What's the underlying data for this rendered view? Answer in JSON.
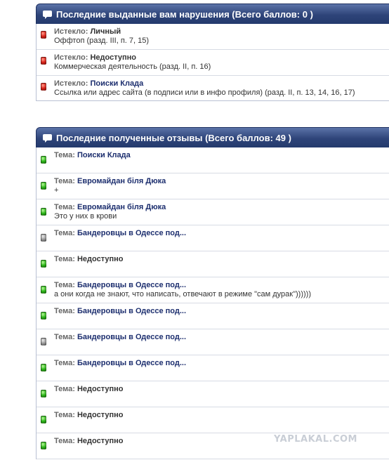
{
  "violations": {
    "header": "Последние выданные вам нарушения (Всего баллов: 0 )",
    "items": [
      {
        "status": "red",
        "label": "Истекло:",
        "title": "Личный",
        "title_style": "plain",
        "detail": "Оффтоп (разд. III, п. 7, 15)"
      },
      {
        "status": "red",
        "label": "Истекло:",
        "title": "Недоступно",
        "title_style": "plain",
        "detail": "Коммерческая деятельность (разд. II, п. 16)"
      },
      {
        "status": "red",
        "label": "Истекло:",
        "title": "Поиски Клада",
        "title_style": "link",
        "detail": "Ссылка или адрес сайта (в подписи или в инфо профиля) (разд. II, п. 13, 14, 16, 17)"
      }
    ]
  },
  "reviews": {
    "header": "Последние полученные отзывы (Всего баллов: 49 )",
    "items": [
      {
        "status": "green",
        "label": "Тема:",
        "title": "Поиски Клада",
        "title_style": "link",
        "detail": ""
      },
      {
        "status": "green",
        "label": "Тема:",
        "title": "Евромайдан біля Дюка",
        "title_style": "link",
        "detail": "+"
      },
      {
        "status": "green",
        "label": "Тема:",
        "title": "Евромайдан біля Дюка",
        "title_style": "link",
        "detail": "Это у них в крови"
      },
      {
        "status": "gray",
        "label": "Тема:",
        "title": "Бандеровцы в Одессе под...",
        "title_style": "link",
        "detail": ""
      },
      {
        "status": "green",
        "label": "Тема:",
        "title": "Недоступно",
        "title_style": "plain",
        "detail": ""
      },
      {
        "status": "green",
        "label": "Тема:",
        "title": "Бандеровцы в Одессе под...",
        "title_style": "link",
        "detail": "а они когда не знают, что написать, отвечают в режиме \"сам дурак\"))))))"
      },
      {
        "status": "green",
        "label": "Тема:",
        "title": "Бандеровцы в Одессе под...",
        "title_style": "link",
        "detail": ""
      },
      {
        "status": "gray",
        "label": "Тема:",
        "title": "Бандеровцы в Одессе под...",
        "title_style": "link",
        "detail": ""
      },
      {
        "status": "green",
        "label": "Тема:",
        "title": "Бандеровцы в Одессе под...",
        "title_style": "link",
        "detail": ""
      },
      {
        "status": "green",
        "label": "Тема:",
        "title": "Недоступно",
        "title_style": "plain",
        "detail": ""
      },
      {
        "status": "green",
        "label": "Тема:",
        "title": "Недоступно",
        "title_style": "plain",
        "detail": ""
      },
      {
        "status": "green",
        "label": "Тема:",
        "title": "Недоступно",
        "title_style": "plain",
        "detail": ""
      }
    ]
  },
  "watermark": "YAPLAKAL.COM",
  "colors": {
    "header_top": "#5b73a8",
    "header_bottom": "#243a6d",
    "link": "#1c2e6e",
    "status_red": "#d9231a",
    "status_green": "#2eb81b",
    "status_gray": "#9c9c9c"
  }
}
